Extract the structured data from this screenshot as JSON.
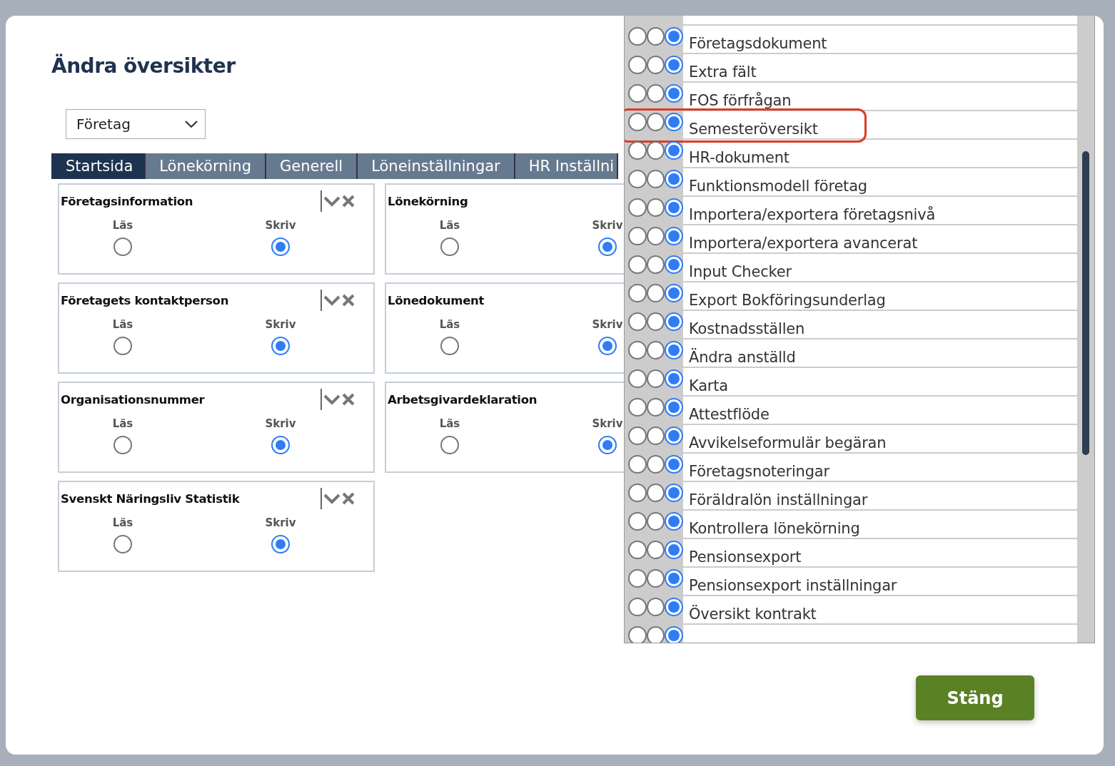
{
  "dialog": {
    "title": "Ändra översikter",
    "close_button": "Stäng"
  },
  "selector": {
    "value": "Företag"
  },
  "tabs": [
    {
      "label": "Startsida",
      "selected": true
    },
    {
      "label": "Lönekörning",
      "selected": false
    },
    {
      "label": "Generell",
      "selected": false
    },
    {
      "label": "Löneinställningar",
      "selected": false
    },
    {
      "label": "HR Inställni",
      "selected": false
    }
  ],
  "cards": [
    {
      "title": "Företagsinformation",
      "removable": true,
      "options": [
        {
          "label": "Läs",
          "selected": false
        },
        {
          "label": "Skriv",
          "selected": true
        }
      ]
    },
    {
      "title": "Lönekörning",
      "removable": false,
      "options": [
        {
          "label": "Läs",
          "selected": false
        },
        {
          "label": "Skriv",
          "selected": true
        }
      ]
    },
    {
      "title": "Företagets kontaktperson",
      "removable": true,
      "options": [
        {
          "label": "Läs",
          "selected": false
        },
        {
          "label": "Skriv",
          "selected": true
        }
      ]
    },
    {
      "title": "Lönedokument",
      "removable": false,
      "options": [
        {
          "label": "Läs",
          "selected": false
        },
        {
          "label": "Skriv",
          "selected": true
        }
      ]
    },
    {
      "title": "Organisationsnummer",
      "removable": true,
      "options": [
        {
          "label": "Läs",
          "selected": false
        },
        {
          "label": "Skriv",
          "selected": true
        }
      ]
    },
    {
      "title": "Arbetsgivardeklaration",
      "removable": false,
      "options": [
        {
          "label": "Läs",
          "selected": false
        },
        {
          "label": "Skriv",
          "selected": true
        }
      ]
    },
    {
      "title": "Svenskt Näringsliv Statistik",
      "removable": true,
      "options": [
        {
          "label": "Läs",
          "selected": false
        },
        {
          "label": "Skriv",
          "selected": true
        }
      ]
    }
  ],
  "overview_list": [
    {
      "label": "Företagsdokument",
      "highlighted": false,
      "choices": [
        {
          "selected": false
        },
        {
          "selected": false
        },
        {
          "selected": true
        }
      ]
    },
    {
      "label": "Extra fält",
      "highlighted": false,
      "choices": [
        {
          "selected": false
        },
        {
          "selected": false
        },
        {
          "selected": true
        }
      ]
    },
    {
      "label": "FOS förfrågan",
      "highlighted": false,
      "choices": [
        {
          "selected": false
        },
        {
          "selected": false
        },
        {
          "selected": true
        }
      ]
    },
    {
      "label": "Semesteröversikt",
      "highlighted": true,
      "choices": [
        {
          "selected": false
        },
        {
          "selected": false
        },
        {
          "selected": true
        }
      ]
    },
    {
      "label": "HR-dokument",
      "highlighted": false,
      "choices": [
        {
          "selected": false
        },
        {
          "selected": false
        },
        {
          "selected": true
        }
      ]
    },
    {
      "label": "Funktionsmodell företag",
      "highlighted": false,
      "choices": [
        {
          "selected": false
        },
        {
          "selected": false
        },
        {
          "selected": true
        }
      ]
    },
    {
      "label": "Importera/exportera företagsnivå",
      "highlighted": false,
      "choices": [
        {
          "selected": false
        },
        {
          "selected": false
        },
        {
          "selected": true
        }
      ]
    },
    {
      "label": "Importera/exportera avancerat",
      "highlighted": false,
      "choices": [
        {
          "selected": false
        },
        {
          "selected": false
        },
        {
          "selected": true
        }
      ]
    },
    {
      "label": "Input Checker",
      "highlighted": false,
      "choices": [
        {
          "selected": false
        },
        {
          "selected": false
        },
        {
          "selected": true
        }
      ]
    },
    {
      "label": "Export Bokföringsunderlag",
      "highlighted": false,
      "choices": [
        {
          "selected": false
        },
        {
          "selected": false
        },
        {
          "selected": true
        }
      ]
    },
    {
      "label": "Kostnadsställen",
      "highlighted": false,
      "choices": [
        {
          "selected": false
        },
        {
          "selected": false
        },
        {
          "selected": true
        }
      ]
    },
    {
      "label": "Ändra anställd",
      "highlighted": false,
      "choices": [
        {
          "selected": false
        },
        {
          "selected": false
        },
        {
          "selected": true
        }
      ]
    },
    {
      "label": "Karta",
      "highlighted": false,
      "choices": [
        {
          "selected": false
        },
        {
          "selected": false
        },
        {
          "selected": true
        }
      ]
    },
    {
      "label": "Attestflöde",
      "highlighted": false,
      "choices": [
        {
          "selected": false
        },
        {
          "selected": false
        },
        {
          "selected": true
        }
      ]
    },
    {
      "label": "Avvikelseformulär begäran",
      "highlighted": false,
      "choices": [
        {
          "selected": false
        },
        {
          "selected": false
        },
        {
          "selected": true
        }
      ]
    },
    {
      "label": "Företagsnoteringar",
      "highlighted": false,
      "choices": [
        {
          "selected": false
        },
        {
          "selected": false
        },
        {
          "selected": true
        }
      ]
    },
    {
      "label": "Föräldralön inställningar",
      "highlighted": false,
      "choices": [
        {
          "selected": false
        },
        {
          "selected": false
        },
        {
          "selected": true
        }
      ]
    },
    {
      "label": "Kontrollera lönekörning",
      "highlighted": false,
      "choices": [
        {
          "selected": false
        },
        {
          "selected": false
        },
        {
          "selected": true
        }
      ]
    },
    {
      "label": "Pensionsexport",
      "highlighted": false,
      "choices": [
        {
          "selected": false
        },
        {
          "selected": false
        },
        {
          "selected": true
        }
      ]
    },
    {
      "label": "Pensionsexport inställningar",
      "highlighted": false,
      "choices": [
        {
          "selected": false
        },
        {
          "selected": false
        },
        {
          "selected": true
        }
      ]
    },
    {
      "label": "Översikt kontrakt",
      "highlighted": false,
      "choices": [
        {
          "selected": false
        },
        {
          "selected": false
        },
        {
          "selected": true
        }
      ]
    },
    {
      "highlighted": false,
      "choices": [
        {
          "selected": false
        },
        {
          "selected": false
        },
        {
          "selected": true
        }
      ]
    }
  ]
}
